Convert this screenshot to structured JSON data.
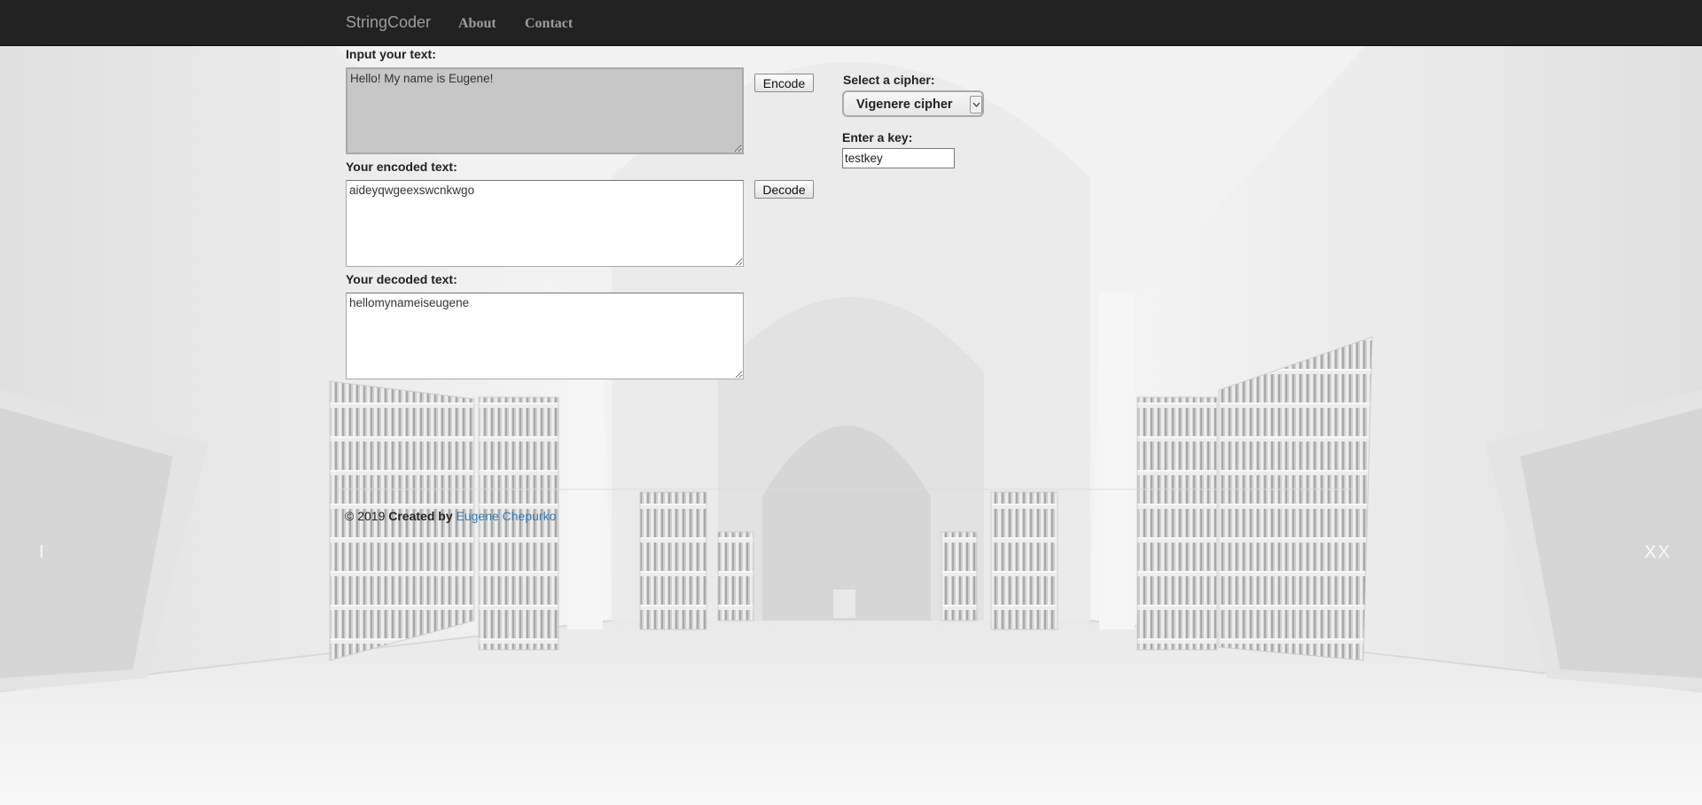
{
  "navbar": {
    "brand": "StringCoder",
    "links": [
      "About",
      "Contact"
    ]
  },
  "form": {
    "input_label": "Input your text:",
    "input_value": "Hello! My name is Eugene!",
    "encoded_label": "Your encoded text:",
    "encoded_value": "aideyqwgeexswcnkwgo",
    "decoded_label": "Your decoded text:",
    "decoded_value": "hellomynameiseugene",
    "encode_button": "Encode",
    "decode_button": "Decode",
    "cipher_label": "Select a cipher:",
    "cipher_selected": "Vigenere cipher",
    "key_label": "Enter a key:",
    "key_value": "testkey"
  },
  "footer": {
    "copyright": "© 2019",
    "created_by": "Created by",
    "author": "Eugene Chepurko"
  },
  "side_marks": {
    "left": "I",
    "right": "XX"
  },
  "colors": {
    "navbar_bg": "#222222",
    "nav_text": "#9d9d9d",
    "link": "#337ab7",
    "input_bg": "#c7c7c7"
  },
  "icons": {
    "select_arrow": "chevron-down-icon"
  }
}
